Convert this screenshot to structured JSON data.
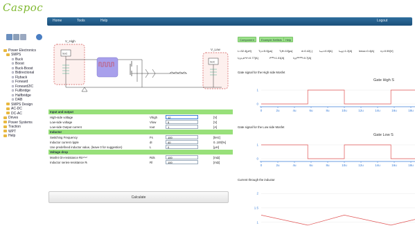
{
  "logo": "Caspoc",
  "nav": {
    "home": "Home",
    "tools": "Tools",
    "help": "Help",
    "logout": "Logout"
  },
  "tree": {
    "power_electronics": "Power Electronics",
    "smps": "SMPS",
    "items": [
      "Buck",
      "Boost",
      "Buck-Boost",
      "Bidirectional",
      "Flyback",
      "Forward",
      "Forward2IC",
      "Fullbridge",
      "Halfbridge",
      "DAB"
    ],
    "smps_design": "SMPS Design",
    "acdc": "AC-DC",
    "dcac": "DC-AC",
    "drives": "Drives",
    "power_systems": "Power Systems",
    "traction": "Traction",
    "wpt": "WPT",
    "help": "Help"
  },
  "circuit": {
    "v_high": "V_High",
    "v_low": "V_Low",
    "src": "SoC"
  },
  "form": {
    "sections": {
      "io": "Input and output",
      "inductor": "Inductor",
      "voltage_drop": "Voltage drop"
    },
    "rows": [
      {
        "label": "High-side voltage",
        "sym": "Vhigh",
        "value": "12",
        "unit": "[V]"
      },
      {
        "label": "Low-side voltage",
        "sym": "Vlow",
        "value": "5",
        "unit": "[V]"
      },
      {
        "label": "Low-side Output current",
        "sym": "Iout",
        "value": "1",
        "unit": "[A]"
      },
      {
        "label": "Switching Frequency",
        "sym": "Fs",
        "value": "100",
        "unit": "[kHz]"
      },
      {
        "label": "Inductor current ripple",
        "sym": "dI",
        "value": "40",
        "unit": "0..100[%]"
      },
      {
        "label": "Use predefined inductor value, (leave 0 for suggestion)",
        "sym": "L",
        "value": "0",
        "unit": "[µH]"
      },
      {
        "label": "Mosfet On-resistance Rᴅˢ⁽ᵒⁿ⁾",
        "sym": "Rds",
        "value": "100",
        "unit": "[mΩ]"
      },
      {
        "label": "Inductor series-resistance Rₗ",
        "sym": "Rl",
        "value": "100",
        "unit": "[mΩ]"
      }
    ],
    "calculate": "Calculate"
  },
  "right_tabs": [
    "Component",
    "Example Netlists",
    "Help"
  ],
  "params": {
    "line1": [
      "L=32.4[µH]",
      "Tₒₙ=5.0[µs]",
      "Tₒff=10[µs]",
      "d=0.42[-]",
      "Iₘᵢₙ=0.8[A]",
      "Iₘₐₓ=1.2[A]",
      "Iᴘᴇᴀᴋ=0.4[A]",
      "vₒ=0.55[V]"
    ],
    "line2": [
      "Iₜᵣₐₙₛᴅᵘᴛʸ=0.77[A]",
      "Iᴸᴼᴺ=1.01[A]",
      "Iₗₒᵥᵢᵈᵉᴸᴼᴺ=0.7[A]"
    ]
  },
  "charts_meta": {
    "label1": "Gate signal for the High side Mosfet",
    "title1": "Gate High S",
    "label2": "Gate signal for the Low side Mosfet",
    "title2": "Gate Low S",
    "label3": "Current through the inductor"
  },
  "chart_data": [
    {
      "type": "line",
      "x_ticks": [
        "0",
        "2u",
        "4u",
        "6u",
        "8u",
        "10u",
        "12u",
        "14u",
        "16u",
        "18u"
      ],
      "y_ticks": [
        "0",
        "1"
      ],
      "series": [
        {
          "x": [
            0,
            5.6,
            5.6,
            10,
            10,
            15.6,
            15.6,
            18.5
          ],
          "y": [
            0,
            0,
            1,
            1,
            0,
            0,
            1,
            1
          ]
        }
      ],
      "xlim": [
        0,
        18.5
      ],
      "ylim": [
        -0.1,
        1.3
      ]
    },
    {
      "type": "line",
      "x_ticks": [
        "0",
        "2u",
        "4u",
        "6u",
        "8u",
        "10u",
        "12u",
        "14u",
        "16u",
        "18u"
      ],
      "y_ticks": [
        "0",
        "1"
      ],
      "series": [
        {
          "x": [
            0,
            5.6,
            5.6,
            10,
            10,
            15.6,
            15.6,
            18.5
          ],
          "y": [
            1,
            1,
            0,
            0,
            1,
            1,
            0,
            0
          ]
        }
      ],
      "xlim": [
        0,
        18.5
      ],
      "ylim": [
        -0.1,
        1.3
      ]
    },
    {
      "type": "line",
      "y_ticks": [
        "1",
        "1.5",
        "2"
      ],
      "series": [
        {
          "x": [
            0,
            5.6,
            10,
            15.6,
            18.5
          ],
          "y": [
            1.25,
            0.9,
            1.25,
            0.9,
            1.1
          ]
        }
      ],
      "xlim": [
        0,
        18.5
      ],
      "ylim": [
        0.85,
        2.1
      ]
    }
  ],
  "colors": {
    "accent_green": "#98e07a",
    "nav_blue": "#1f5a87",
    "trace_red": "#e05050",
    "axis_blue": "#3a7dd8"
  }
}
